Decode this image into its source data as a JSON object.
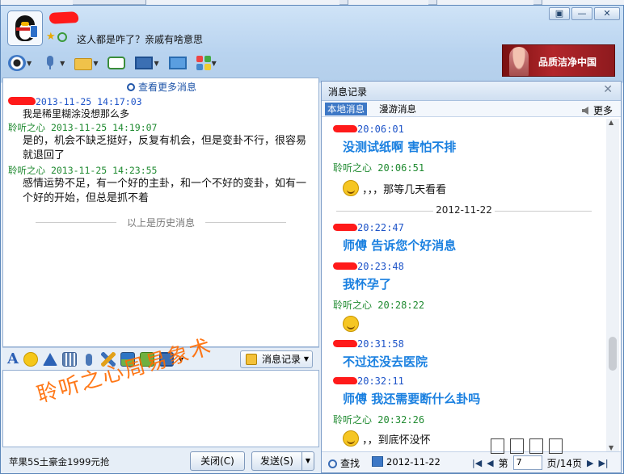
{
  "header": {
    "signature": "这人都是咋了？亲戚有啥意思",
    "window_buttons": [
      "▣",
      "—",
      "✕"
    ]
  },
  "toolbar": {
    "items": [
      "camera-icon",
      "microphone-icon",
      "folder-icon",
      "message-icon",
      "screen-icon",
      "share-icon",
      "apps-icon"
    ],
    "ad_text": "品质洁净中国"
  },
  "chat": {
    "more_history": "查看更多消息",
    "messages": [
      {
        "sender": "",
        "time": "2013-11-25 14:17:03",
        "text": "我是稀里糊涂没想那么多"
      },
      {
        "sender": "聆听之心",
        "time": "2013-11-25 14:19:07",
        "text": "是的，机会不缺乏挺好，反复有机会，但是变卦不行，很容易就退回了"
      },
      {
        "sender": "聆听之心",
        "time": "2013-11-25 14:23:55",
        "text": "感情运势不足，有一个好的主卦，和一个不好的变卦，如有一个好的开始，但总是抓不着"
      }
    ],
    "history_separator": "以上是历史消息"
  },
  "input": {
    "history_button": "消息记录",
    "watermark": "聆听之心周易象术"
  },
  "bottom": {
    "ad_line": "苹果5S土豪金1999元抢",
    "close_button": "关闭(C)",
    "send_button": "发送(S)"
  },
  "history_panel": {
    "title": "消息记录",
    "tab_local": "本地消息",
    "tab_roaming": "漫游消息",
    "more": "更多",
    "entries": [
      {
        "sender": "",
        "time": "20:06:01",
        "text": "没测试纸啊   害怕不排"
      },
      {
        "sender": "聆听之心",
        "time": "20:06:51",
        "text": "，，，那等几天看看"
      },
      {
        "date": "2012-11-22"
      },
      {
        "sender": "",
        "time": "20:22:47",
        "text": "师傅   告诉您个好消息"
      },
      {
        "sender": "",
        "time": "20:23:48",
        "text": "我怀孕了"
      },
      {
        "sender": "聆听之心",
        "time": "20:28:22",
        "text": ""
      },
      {
        "sender": "",
        "time": "20:31:58",
        "text": "不过还没去医院"
      },
      {
        "sender": "",
        "time": "20:32:11",
        "text": "师傅   我还需要断什么卦吗"
      },
      {
        "sender": "聆听之心",
        "time": "20:32:26",
        "text": "，，到底怀没怀"
      }
    ],
    "search": "查找",
    "date_value": "2012-11-22",
    "page_label_prefix": "第",
    "page_value": "7",
    "page_label_suffix": "页/14页"
  },
  "colors": {
    "sender_me": "#1e54c8",
    "sender_other": "#1f8a30",
    "highlight_text": "#1a80e0",
    "watermark": "#ff6a00"
  }
}
